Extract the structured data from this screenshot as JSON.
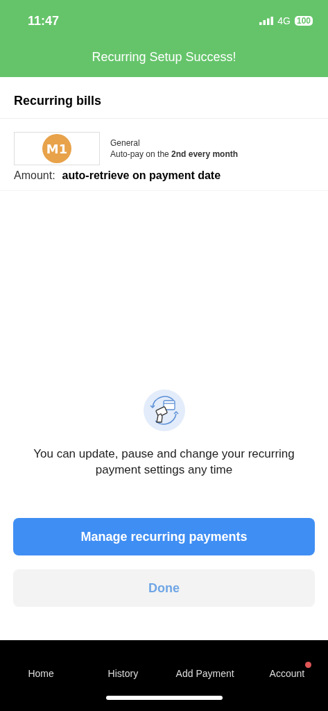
{
  "status_bar": {
    "time": "11:47",
    "network": "4G",
    "battery": "100"
  },
  "header": {
    "title": "Recurring Setup Success!"
  },
  "section": {
    "title": "Recurring bills"
  },
  "bill": {
    "logo_text": "M1",
    "category": "General",
    "schedule": "Auto-pay on the **2nd every month**",
    "amount_label": "Amount:",
    "amount_value": "auto-retrieve on payment date"
  },
  "info": {
    "text": "You can update, pause and change your recurring payment settings any time"
  },
  "buttons": [
    {
      "label": "Manage recurring payments",
      "kind": "primary"
    },
    {
      "label": "Done",
      "kind": "secondary"
    }
  ],
  "nav": [
    {
      "label": "Home",
      "badge": false
    },
    {
      "label": "History",
      "badge": false
    },
    {
      "label": "Add Payment",
      "badge": false
    },
    {
      "label": "Account",
      "badge": true
    }
  ]
}
